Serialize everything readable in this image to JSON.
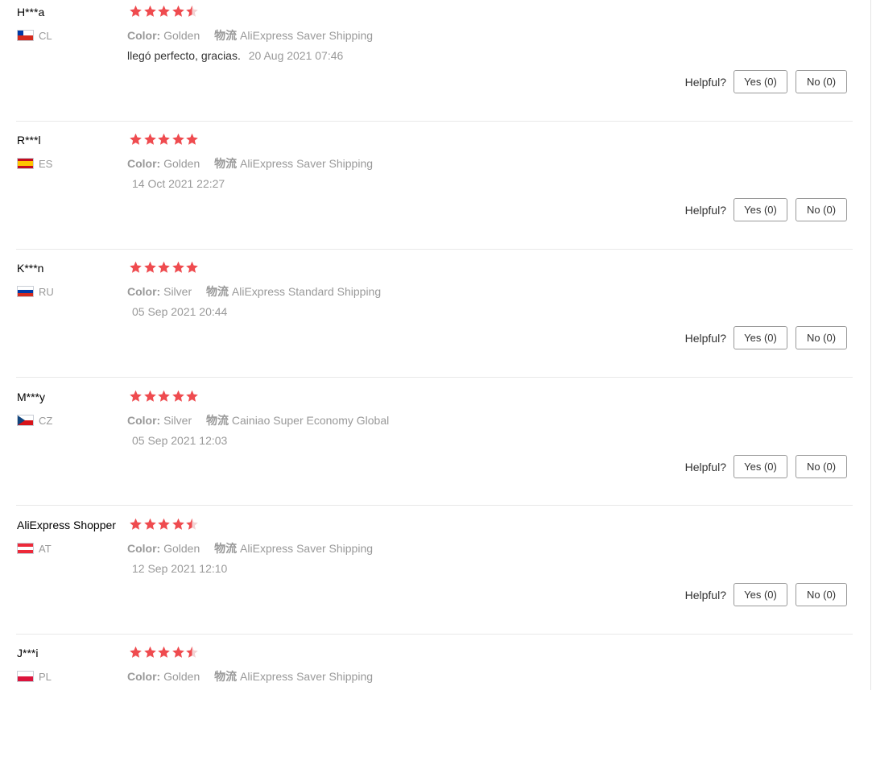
{
  "colors": {
    "star": "#ef4b4f",
    "muted": "#999999"
  },
  "reviews": [
    {
      "user": "H***a",
      "country": "CL",
      "flag": "flag-chile-icon",
      "rating": 4.5,
      "color_label": "Color:",
      "color_value": "Golden",
      "logistics_label": "物流",
      "logistics_value": "AliExpress Saver Shipping",
      "text": "llegó perfecto, gracias.",
      "date": "20 Aug 2021 07:46",
      "helpful_label": "Helpful?",
      "yes_label": "Yes (0)",
      "no_label": "No (0)"
    },
    {
      "user": "R***l",
      "country": "ES",
      "flag": "flag-spain-icon",
      "rating": 5,
      "color_label": "Color:",
      "color_value": "Golden",
      "logistics_label": "物流",
      "logistics_value": "AliExpress Saver Shipping",
      "text": "",
      "date": "14 Oct 2021 22:27",
      "helpful_label": "Helpful?",
      "yes_label": "Yes (0)",
      "no_label": "No (0)"
    },
    {
      "user": "K***n",
      "country": "RU",
      "flag": "flag-russia-icon",
      "rating": 5,
      "color_label": "Color:",
      "color_value": "Silver",
      "logistics_label": "物流",
      "logistics_value": "AliExpress Standard Shipping",
      "text": "",
      "date": "05 Sep 2021 20:44",
      "helpful_label": "Helpful?",
      "yes_label": "Yes (0)",
      "no_label": "No (0)"
    },
    {
      "user": "M***y",
      "country": "CZ",
      "flag": "flag-czech-icon",
      "rating": 5,
      "color_label": "Color:",
      "color_value": "Silver",
      "logistics_label": "物流",
      "logistics_value": "Cainiao Super Economy Global",
      "text": "",
      "date": "05 Sep 2021 12:03",
      "helpful_label": "Helpful?",
      "yes_label": "Yes (0)",
      "no_label": "No (0)"
    },
    {
      "user": "AliExpress Shopper",
      "country": "AT",
      "flag": "flag-austria-icon",
      "rating": 4.5,
      "color_label": "Color:",
      "color_value": "Golden",
      "logistics_label": "物流",
      "logistics_value": "AliExpress Saver Shipping",
      "text": "",
      "date": "12 Sep 2021 12:10",
      "helpful_label": "Helpful?",
      "yes_label": "Yes (0)",
      "no_label": "No (0)"
    },
    {
      "user": "J***i",
      "country": "PL",
      "flag": "flag-poland-icon",
      "rating": 4.5,
      "color_label": "Color:",
      "color_value": "Golden",
      "logistics_label": "物流",
      "logistics_value": "AliExpress Saver Shipping",
      "text": "",
      "date": "",
      "helpful_label": "",
      "yes_label": "",
      "no_label": ""
    }
  ]
}
